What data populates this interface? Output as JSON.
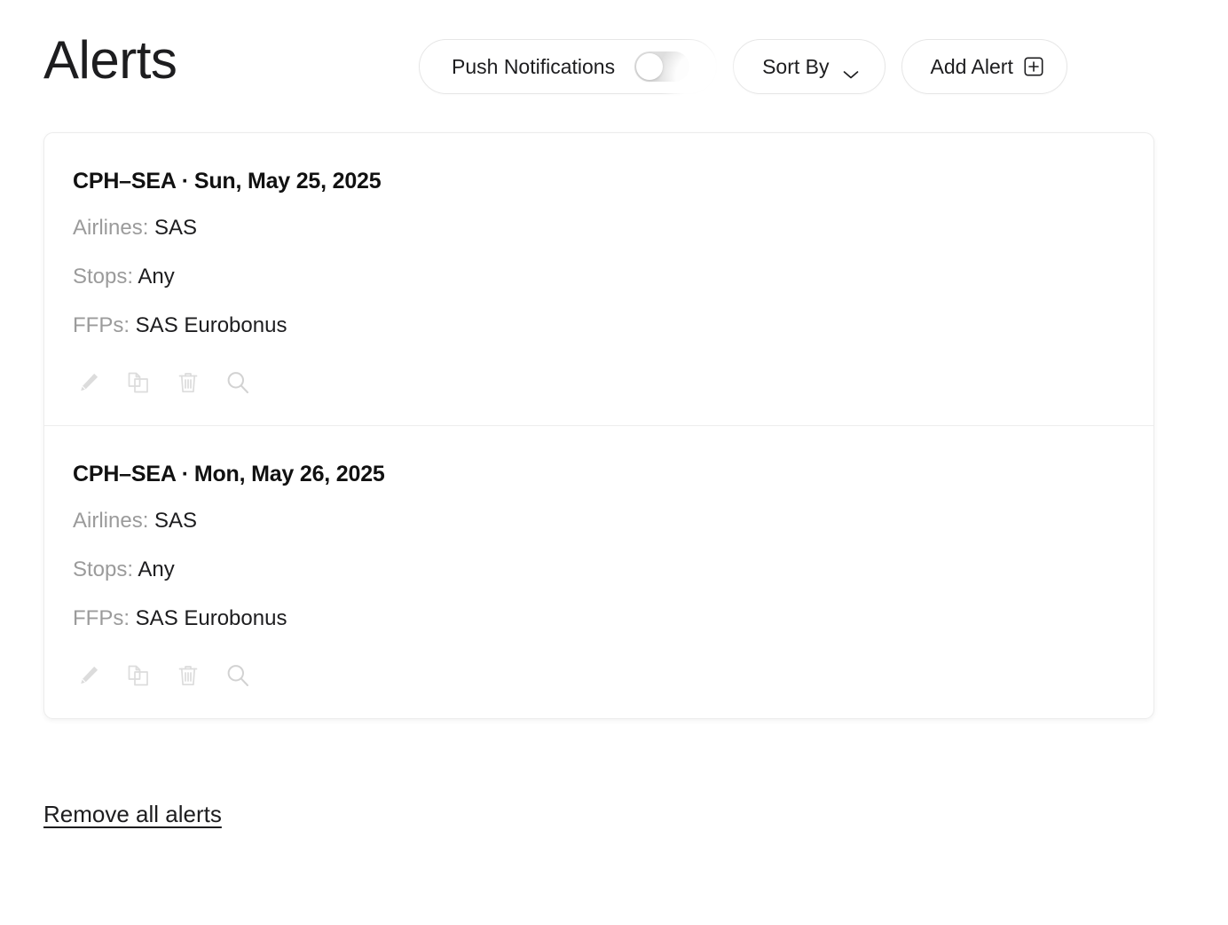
{
  "header": {
    "title": "Alerts",
    "push_notifications": {
      "label": "Push Notifications",
      "state": "off"
    },
    "sort_by": {
      "label": "Sort By",
      "icon": "chevron-down-icon"
    },
    "add_alert": {
      "label": "Add Alert",
      "icon": "plus-square-icon"
    }
  },
  "alerts": [
    {
      "route": "CPH–SEA",
      "separator": "·",
      "date": "Sun, May 25, 2025",
      "airlines_label": "Airlines:",
      "airlines_value": "SAS",
      "stops_label": "Stops:",
      "stops_value": "Any",
      "ffps_label": "FFPs:",
      "ffps_value": "SAS Eurobonus"
    },
    {
      "route": "CPH–SEA",
      "separator": "·",
      "date": "Mon, May 26, 2025",
      "airlines_label": "Airlines:",
      "airlines_value": "SAS",
      "stops_label": "Stops:",
      "stops_value": "Any",
      "ffps_label": "FFPs:",
      "ffps_value": "SAS Eurobonus"
    }
  ],
  "row_actions": [
    {
      "name": "edit-icon",
      "title": "Edit"
    },
    {
      "name": "duplicate-icon",
      "title": "Duplicate"
    },
    {
      "name": "trash-icon",
      "title": "Delete"
    },
    {
      "name": "search-icon",
      "title": "Search"
    }
  ],
  "footer": {
    "remove_all_label": "Remove all alerts"
  },
  "colors": {
    "page_background": "#ffffff",
    "card_background": "#ffffff",
    "card_border": "#ececec",
    "text_primary": "#1d1d1f",
    "text_muted": "#9b9b9b",
    "icon_muted": "#d8d8d8",
    "toggle_track": "#dedede",
    "toggle_knob": "#ffffff"
  }
}
